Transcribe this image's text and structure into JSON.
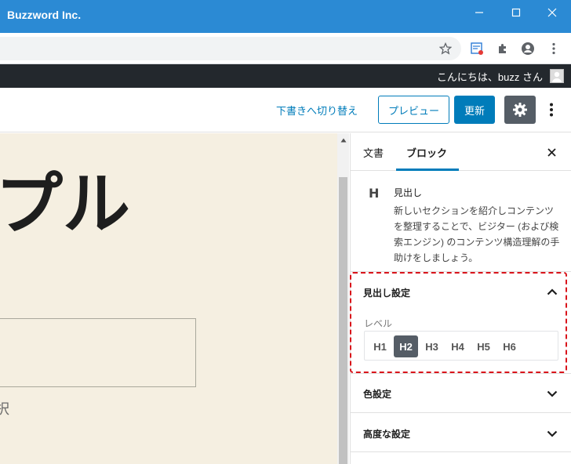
{
  "window": {
    "title": "Buzzword Inc."
  },
  "adminbar": {
    "greeting": "こんにちは、buzz さん"
  },
  "header": {
    "draft_link": "下書きへ切り替え",
    "preview_label": "プレビュー",
    "update_label": "更新"
  },
  "canvas": {
    "title_fragment": "プル",
    "text_fragment": "択"
  },
  "sidebar": {
    "tabs": [
      {
        "label": "文書"
      },
      {
        "label": "ブロック"
      }
    ],
    "block": {
      "icon_text": "H",
      "name": "見出し",
      "description": "新しいセクションを紹介しコンテンツを整理することで、ビジター (および検索エンジン) のコンテンツ構造理解の手助けをしましょう。"
    },
    "panels": {
      "heading_settings": {
        "title": "見出し設定",
        "level_label": "レベル",
        "levels": [
          "H1",
          "H2",
          "H3",
          "H4",
          "H5",
          "H6"
        ],
        "selected_level": "H2"
      },
      "color_settings": {
        "title": "色設定"
      },
      "advanced": {
        "title": "高度な設定"
      }
    }
  },
  "colors": {
    "titlebar": "#2b8ad4",
    "accent": "#007cba",
    "adminbar": "#23282d",
    "canvas_bg": "#f5efe1",
    "highlight": "#d9141b"
  }
}
